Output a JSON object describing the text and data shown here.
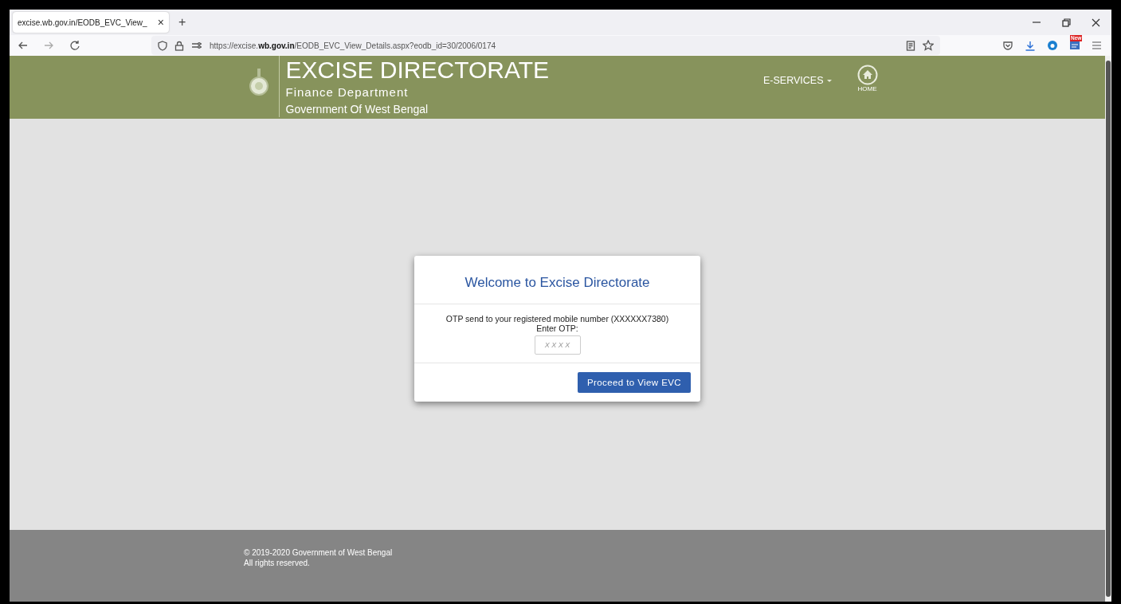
{
  "browser": {
    "tab": {
      "title": "excise.wb.gov.in/EODB_EVC_View_",
      "close": "×"
    },
    "new_tab": "+",
    "url": "https://excise.**wb.gov.in**/EODB_EVC_View_Details.aspx?eodb_id=30/2006/0174",
    "badge": "New"
  },
  "header": {
    "title": "EXCISE DIRECTORATE",
    "subtitle": "Finance Department",
    "tagline": "Government Of West Bengal",
    "menu": "E-SERVICES",
    "home_label": "HOME"
  },
  "modal": {
    "title": "Welcome to Excise Directorate",
    "message": "OTP send to your registered mobile number (XXXXXX7380)",
    "otp_label": "Enter OTP:",
    "otp_field": {
      "placeholder": "X X X X"
    },
    "button": "Proceed to View EVC"
  },
  "footer": {
    "copyright": "© 2019-2020 Government of West Bengal",
    "rights": "All rights reserved."
  }
}
